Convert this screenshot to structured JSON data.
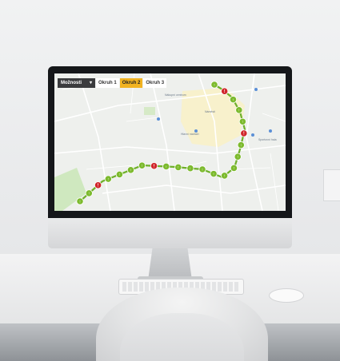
{
  "toolbar": {
    "options_label": "Možnosti",
    "tabs": [
      {
        "label": "Okruh 1",
        "active": false
      },
      {
        "label": "Okruh 2",
        "active": true
      },
      {
        "label": "Okruh 3",
        "active": false
      }
    ]
  },
  "map": {
    "labels": [
      "Nákupní centrum",
      "Náměstí",
      "Hlavní nádraží",
      "Sportovní hala"
    ],
    "markers": [
      {
        "type": "ok"
      },
      {
        "type": "ok"
      },
      {
        "type": "warning"
      },
      {
        "type": "ok"
      },
      {
        "type": "ok"
      },
      {
        "type": "ok"
      },
      {
        "type": "ok"
      },
      {
        "type": "warning"
      },
      {
        "type": "ok"
      },
      {
        "type": "ok"
      },
      {
        "type": "ok"
      },
      {
        "type": "ok"
      },
      {
        "type": "ok"
      },
      {
        "type": "ok"
      },
      {
        "type": "ok"
      },
      {
        "type": "ok"
      },
      {
        "type": "ok"
      },
      {
        "type": "warning"
      },
      {
        "type": "ok"
      },
      {
        "type": "ok"
      },
      {
        "type": "ok"
      },
      {
        "type": "warning"
      },
      {
        "type": "ok"
      }
    ]
  },
  "colors": {
    "ok_marker": "#7cba2d",
    "warning_marker": "#d0262b",
    "active_tab": "#f2b320",
    "route": "#6fb02a"
  }
}
